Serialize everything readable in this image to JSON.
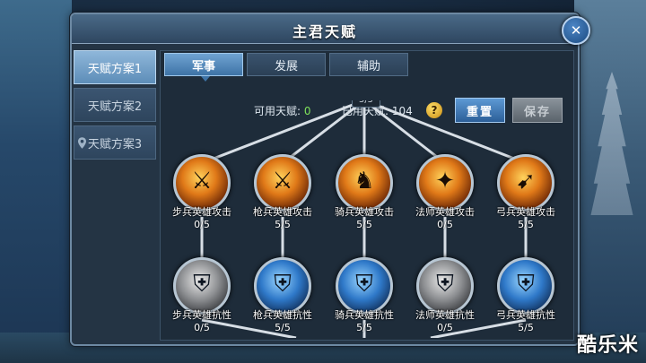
{
  "window": {
    "title": "主君天赋"
  },
  "plans": [
    {
      "label": "天赋方案1",
      "active": true
    },
    {
      "label": "天赋方案2",
      "active": false
    },
    {
      "label": "天赋方案3",
      "active": false
    }
  ],
  "tabs": [
    {
      "label": "军事",
      "active": true
    },
    {
      "label": "发展",
      "active": false
    },
    {
      "label": "辅助",
      "active": false
    }
  ],
  "stats": {
    "available_label": "可用天赋:",
    "available_value": "0",
    "used_label": "已用天赋:",
    "used_value": "104"
  },
  "buttons": {
    "reset": "重置",
    "save": "保存",
    "help": "?"
  },
  "tree": {
    "top_level": "5/5",
    "attack_row": [
      {
        "name": "步兵英雄攻击",
        "level": "0/5",
        "icon": "infantry-attack-icon"
      },
      {
        "name": "枪兵英雄攻击",
        "level": "5/5",
        "icon": "spearman-attack-icon"
      },
      {
        "name": "骑兵英雄攻击",
        "level": "5/5",
        "icon": "cavalry-attack-icon"
      },
      {
        "name": "法师英雄攻击",
        "level": "0/5",
        "icon": "mage-attack-icon"
      },
      {
        "name": "弓兵英雄攻击",
        "level": "5/5",
        "icon": "archer-attack-icon"
      }
    ],
    "defense_row": [
      {
        "name": "步兵英雄抗性",
        "level": "0/5",
        "icon": "infantry-resist-icon"
      },
      {
        "name": "枪兵英雄抗性",
        "level": "5/5",
        "icon": "spearman-resist-icon"
      },
      {
        "name": "骑兵英雄抗性",
        "level": "5/5",
        "icon": "cavalry-resist-icon"
      },
      {
        "name": "法师英雄抗性",
        "level": "0/5",
        "icon": "mage-resist-icon"
      },
      {
        "name": "弓兵英雄抗性",
        "level": "5/5",
        "icon": "archer-resist-icon"
      }
    ]
  },
  "watermark": "酷乐米"
}
